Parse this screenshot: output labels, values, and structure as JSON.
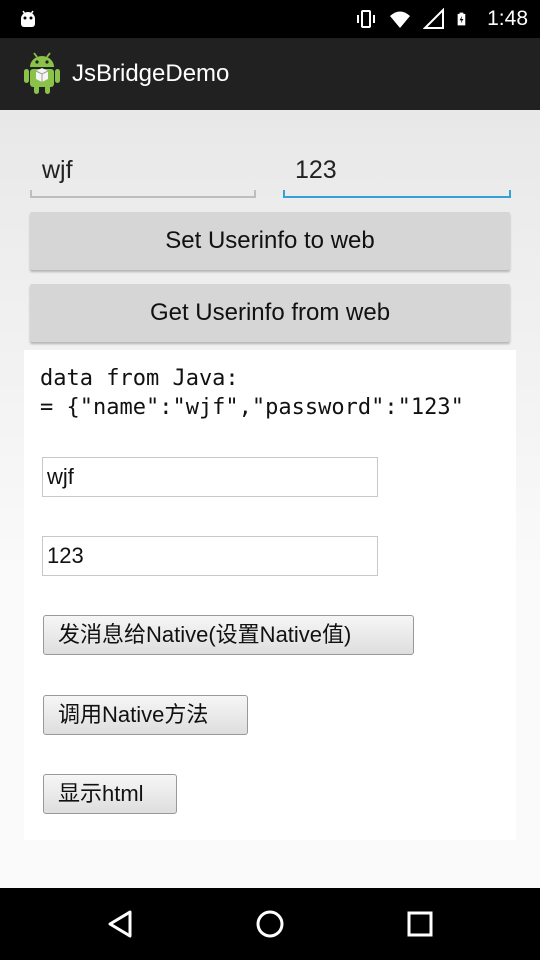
{
  "status_bar": {
    "time": "1:48",
    "icons": [
      "android-debug-icon",
      "vibrate-icon",
      "wifi-icon",
      "signal-icon",
      "battery-charging-icon"
    ]
  },
  "action_bar": {
    "title": "JsBridgeDemo",
    "icon": "android-robot-icon"
  },
  "native": {
    "username_value": "wjf",
    "password_value": "123",
    "set_button": "Set Userinfo to web",
    "get_button": "Get Userinfo from web"
  },
  "webview": {
    "text_line1": "data from Java:",
    "text_line2": "= {\"name\":\"wjf\",\"password\":\"123\"",
    "username_value": "wjf",
    "password_value": "123",
    "send_button": "发消息给Native(设置Native值)",
    "call_button": "调用Native方法",
    "show_button": "显示html"
  },
  "nav_bar": {
    "icons": [
      "back-icon",
      "home-icon",
      "recent-apps-icon"
    ]
  },
  "colors": {
    "accent": "#33a0d8",
    "action_bar": "#212121",
    "button": "#d6d6d6"
  }
}
